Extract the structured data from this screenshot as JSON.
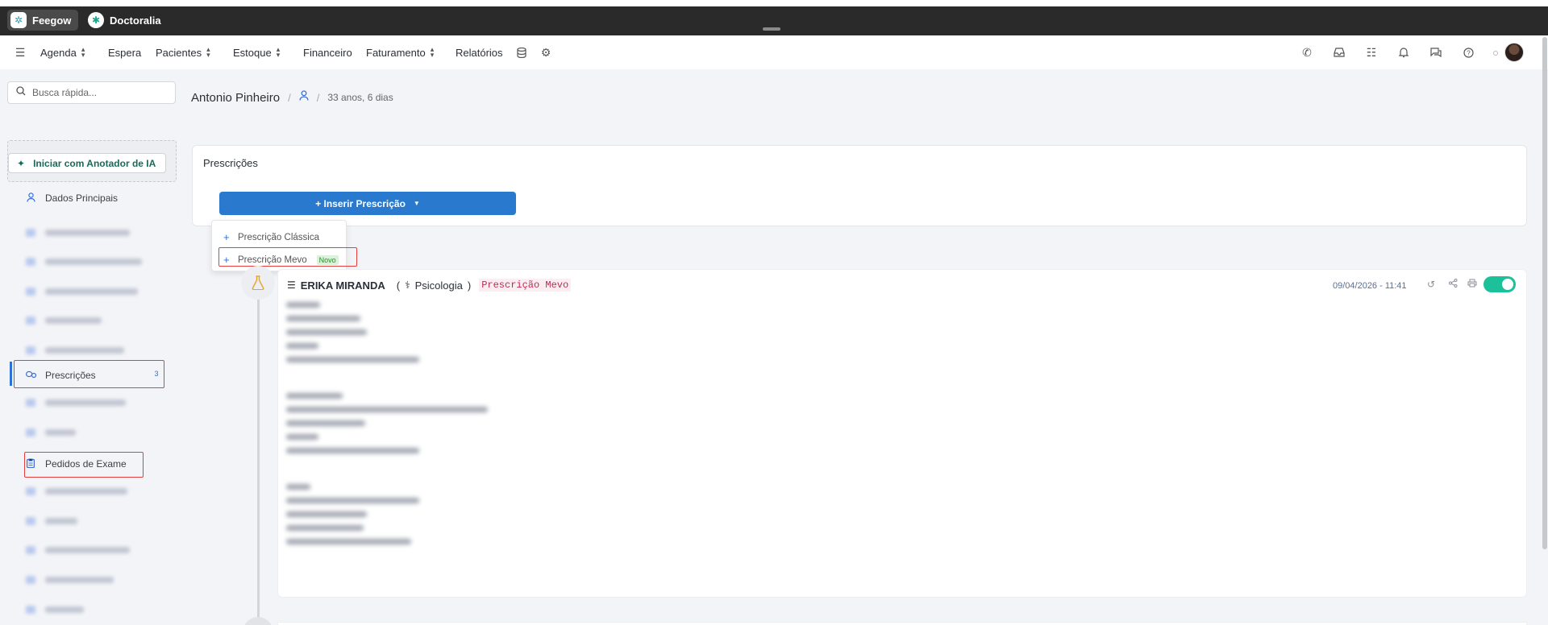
{
  "appbar": {
    "tabs": [
      {
        "label": "Feegow",
        "icon": "feegow-logo"
      },
      {
        "label": "Doctoralia",
        "icon": "doctoralia-logo"
      }
    ]
  },
  "nav": {
    "items": [
      {
        "label": "Agenda",
        "has_chevron": true
      },
      {
        "label": "Espera",
        "has_chevron": false
      },
      {
        "label": "Pacientes",
        "has_chevron": true
      },
      {
        "label": "Estoque",
        "has_chevron": true
      },
      {
        "label": "Financeiro",
        "has_chevron": false
      },
      {
        "label": "Faturamento",
        "has_chevron": true
      },
      {
        "label": "Relatórios",
        "has_chevron": false
      }
    ],
    "right_icons": [
      "phone-icon",
      "inbox-icon",
      "task-list-icon",
      "bell-icon",
      "chat-icon",
      "help-icon"
    ]
  },
  "sidebar": {
    "search_placeholder": "Busca rápida...",
    "ai_button": "Iniciar com Anotador de IA",
    "items": [
      {
        "label": "Dados Principais",
        "icon": "user-icon"
      },
      {
        "label": "Prescrições",
        "icon": "pills-icon",
        "count": "3",
        "active": true
      },
      {
        "label": "Pedidos de Exame",
        "icon": "clipboard-icon"
      }
    ]
  },
  "patient": {
    "name": "Antonio Pinheiro",
    "age": "33 anos, 6 dias"
  },
  "prescriptions_card": {
    "title": "Prescrições",
    "insert_button": "+ Inserir Prescrição",
    "dropdown": [
      {
        "label": "Prescrição Clássica"
      },
      {
        "label": "Prescrição Mevo",
        "badge": "Novo"
      }
    ]
  },
  "record": {
    "doctor": "ERIKA MIRANDA",
    "specialty_open": "(",
    "specialty": "Psicologia",
    "specialty_close": ")",
    "type": "Prescrição Mevo",
    "datetime": "09/04/2026 - 11:41",
    "enabled": true
  },
  "colors": {
    "primary": "#2979cf",
    "highlight": "#e53e3e",
    "toggle": "#1cc19a",
    "appbar": "#2a2a2a"
  }
}
